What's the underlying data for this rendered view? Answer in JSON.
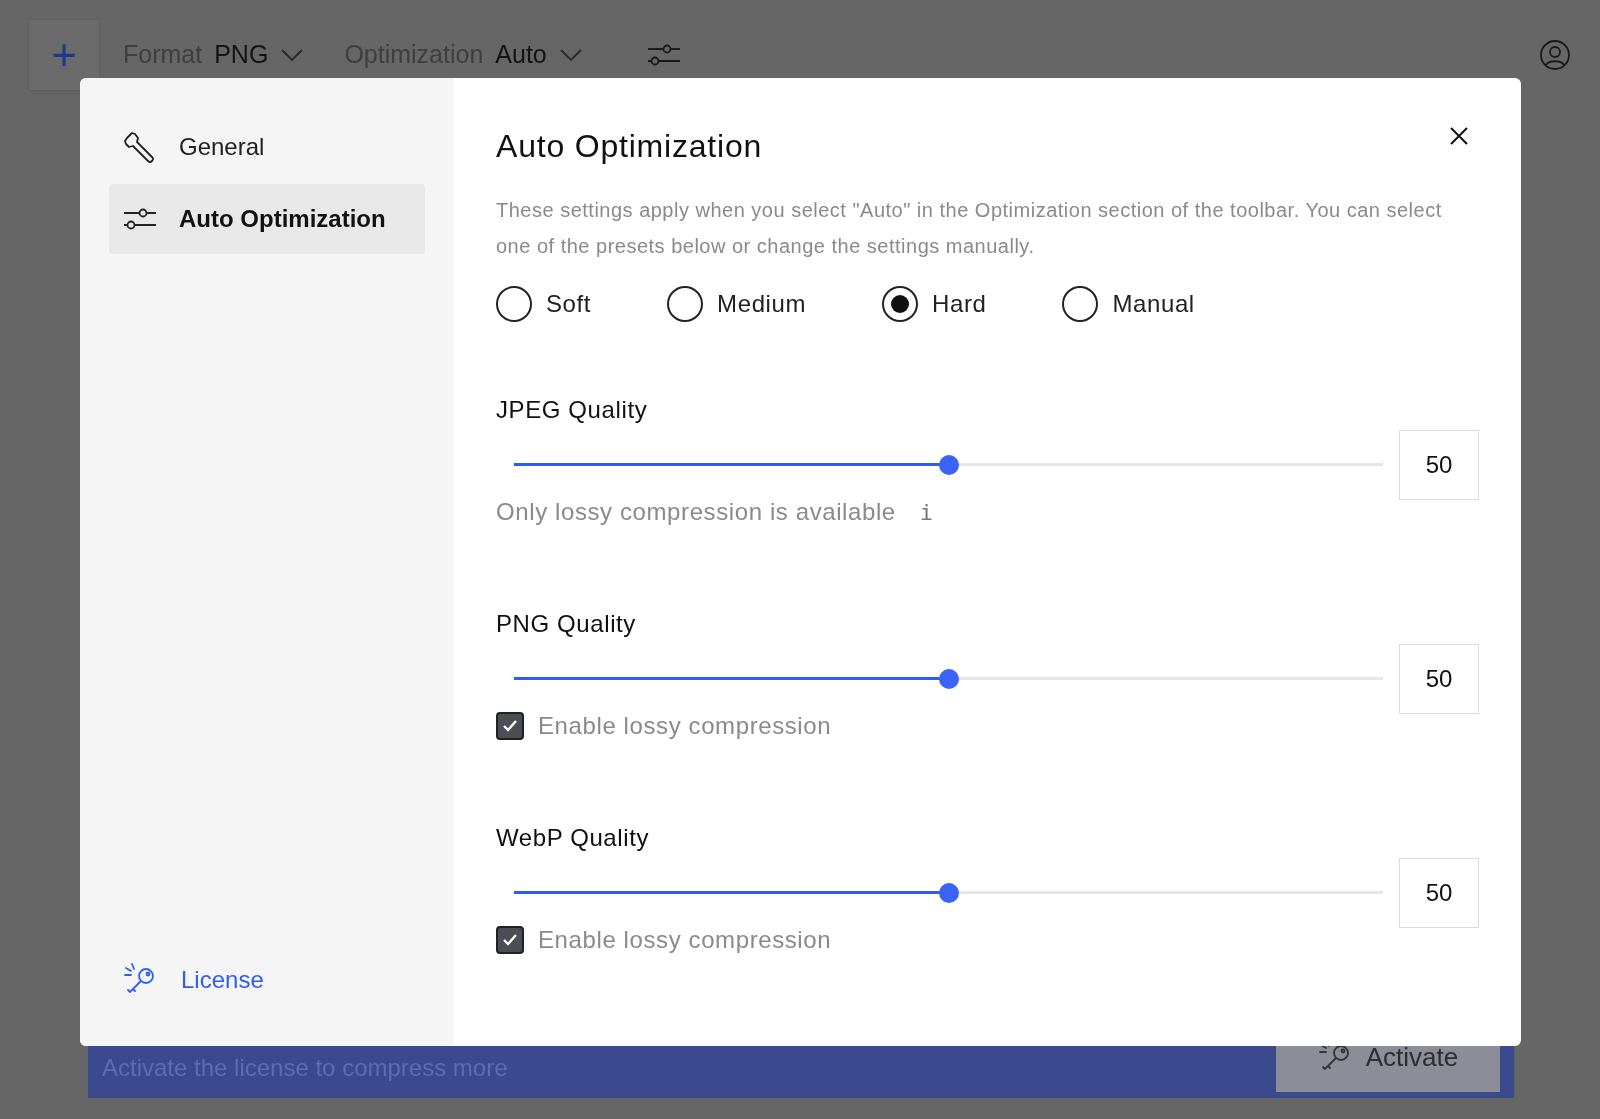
{
  "toolbar": {
    "add_button": "+",
    "format": {
      "label": "Format",
      "value": "PNG"
    },
    "optimization": {
      "label": "Optimization",
      "value": "Auto"
    }
  },
  "banner": {
    "text": "Activate the license to compress more",
    "button": "Activate"
  },
  "sidebar": {
    "items": [
      {
        "label": "General",
        "kind": "wrench",
        "selected": false
      },
      {
        "label": "Auto Optimization",
        "kind": "sliders",
        "selected": true
      }
    ],
    "license": "License"
  },
  "dialog": {
    "title": "Auto Optimization",
    "description": "These settings apply when you select \"Auto\" in the Optimization section of the toolbar. You can select one of the presets below or change the settings manually.",
    "presets": [
      {
        "label": "Soft",
        "selected": false
      },
      {
        "label": "Medium",
        "selected": false
      },
      {
        "label": "Hard",
        "selected": true
      },
      {
        "label": "Manual",
        "selected": false
      }
    ],
    "qualities": [
      {
        "title": "JPEG Quality",
        "level": 0.5,
        "value": "50",
        "kind": "note",
        "note": "Only lossy compression is available",
        "note_icon": "i"
      },
      {
        "title": "PNG Quality",
        "level": 0.5,
        "value": "50",
        "kind": "checkbox",
        "label": "Enable lossy compression",
        "checked": true
      },
      {
        "title": "WebP Quality",
        "level": 0.5,
        "value": "50",
        "kind": "checkbox",
        "label": "Enable lossy compression",
        "checked": true
      }
    ]
  }
}
